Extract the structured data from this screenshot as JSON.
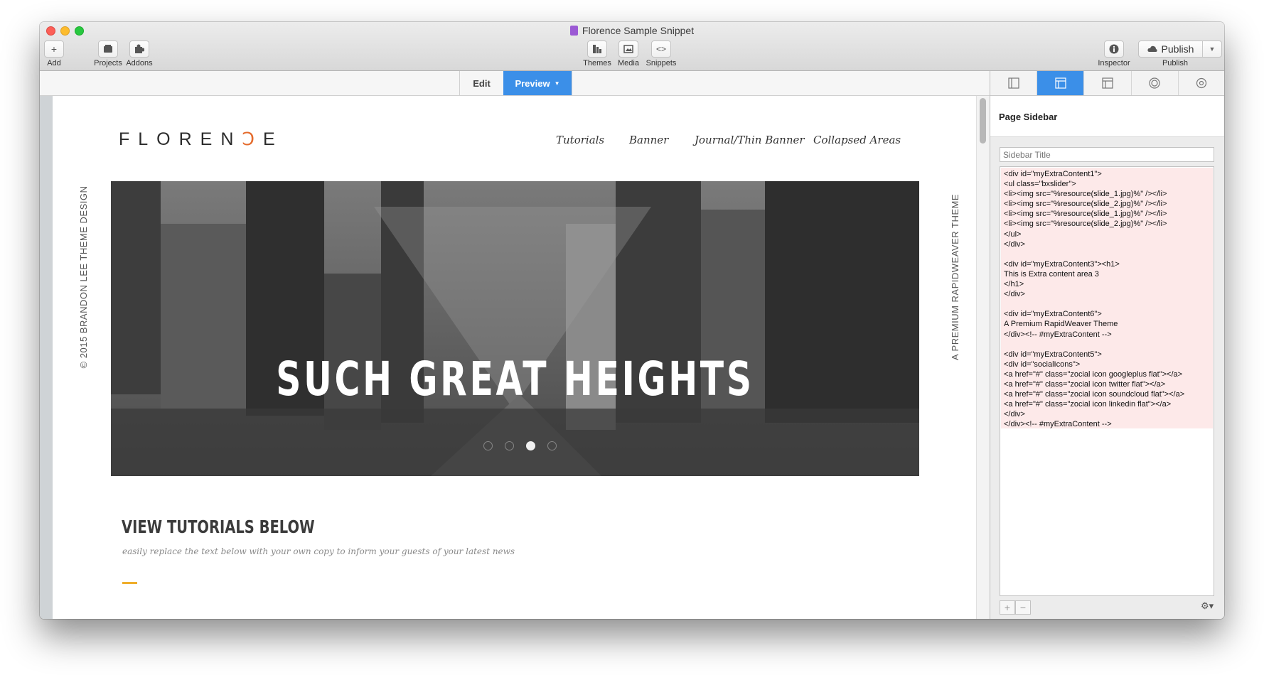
{
  "window": {
    "title": "Florence Sample Snippet"
  },
  "toolbar": {
    "add": "Add",
    "projects": "Projects",
    "addons": "Addons",
    "themes": "Themes",
    "media": "Media",
    "snippets": "Snippets",
    "inspector": "Inspector",
    "publish_button": "Publish",
    "publish_label": "Publish"
  },
  "modes": {
    "edit": "Edit",
    "preview": "Preview"
  },
  "site": {
    "logo_a": "FLOREN",
    "logo_o": "Ↄ",
    "logo_b": "E",
    "nav": [
      "Tutorials",
      "Banner",
      "Journal/Thin Banner",
      "Collapsed Areas"
    ],
    "side_left": "© 2015 BRANDON LEE THEME DESIGN",
    "side_right": "A PREMIUM RAPIDWEAVER THEME",
    "hero_title": "SUCH GREAT HEIGHTS",
    "section_title": "VIEW TUTORIALS BELOW",
    "section_subtitle": "easily replace the text below with your own copy to inform your guests of your latest news"
  },
  "inspector": {
    "header": "Page Sidebar",
    "sidebar_title_placeholder": "Sidebar Title",
    "code": "<div id=\"myExtraContent1\">\n<ul class=\"bxslider\">\n<li><img src=\"%resource(slide_1.jpg)%\" /></li>\n<li><img src=\"%resource(slide_2.jpg)%\" /></li>\n<li><img src=\"%resource(slide_1.jpg)%\" /></li>\n<li><img src=\"%resource(slide_2.jpg)%\" /></li>\n</ul>\n</div>\n\n<div id=\"myExtraContent3\"><h1>\nThis is Extra content area 3\n</h1>\n</div>\n\n<div id=\"myExtraContent6\">\nA Premium RapidWeaver Theme\n</div><!-- #myExtraContent -->\n\n<div id=\"myExtraContent5\">\n<div id=\"socialIcons\">\n<a href=\"#\" class=\"zocial icon googleplus flat\"></a>\n<a href=\"#\" class=\"zocial icon twitter flat\"></a>\n<a href=\"#\" class=\"zocial icon soundcloud flat\"></a>\n<a href=\"#\" class=\"zocial icon linkedin flat\"></a>\n</div>\n</div><!-- #myExtraContent -->",
    "add_symbol": "+",
    "remove_symbol": "−"
  },
  "colors": {
    "accent_blue": "#3b8fe8",
    "logo_orange": "#e46a2b",
    "accent_gold": "#efae2c",
    "code_highlight": "#fde9e9"
  }
}
